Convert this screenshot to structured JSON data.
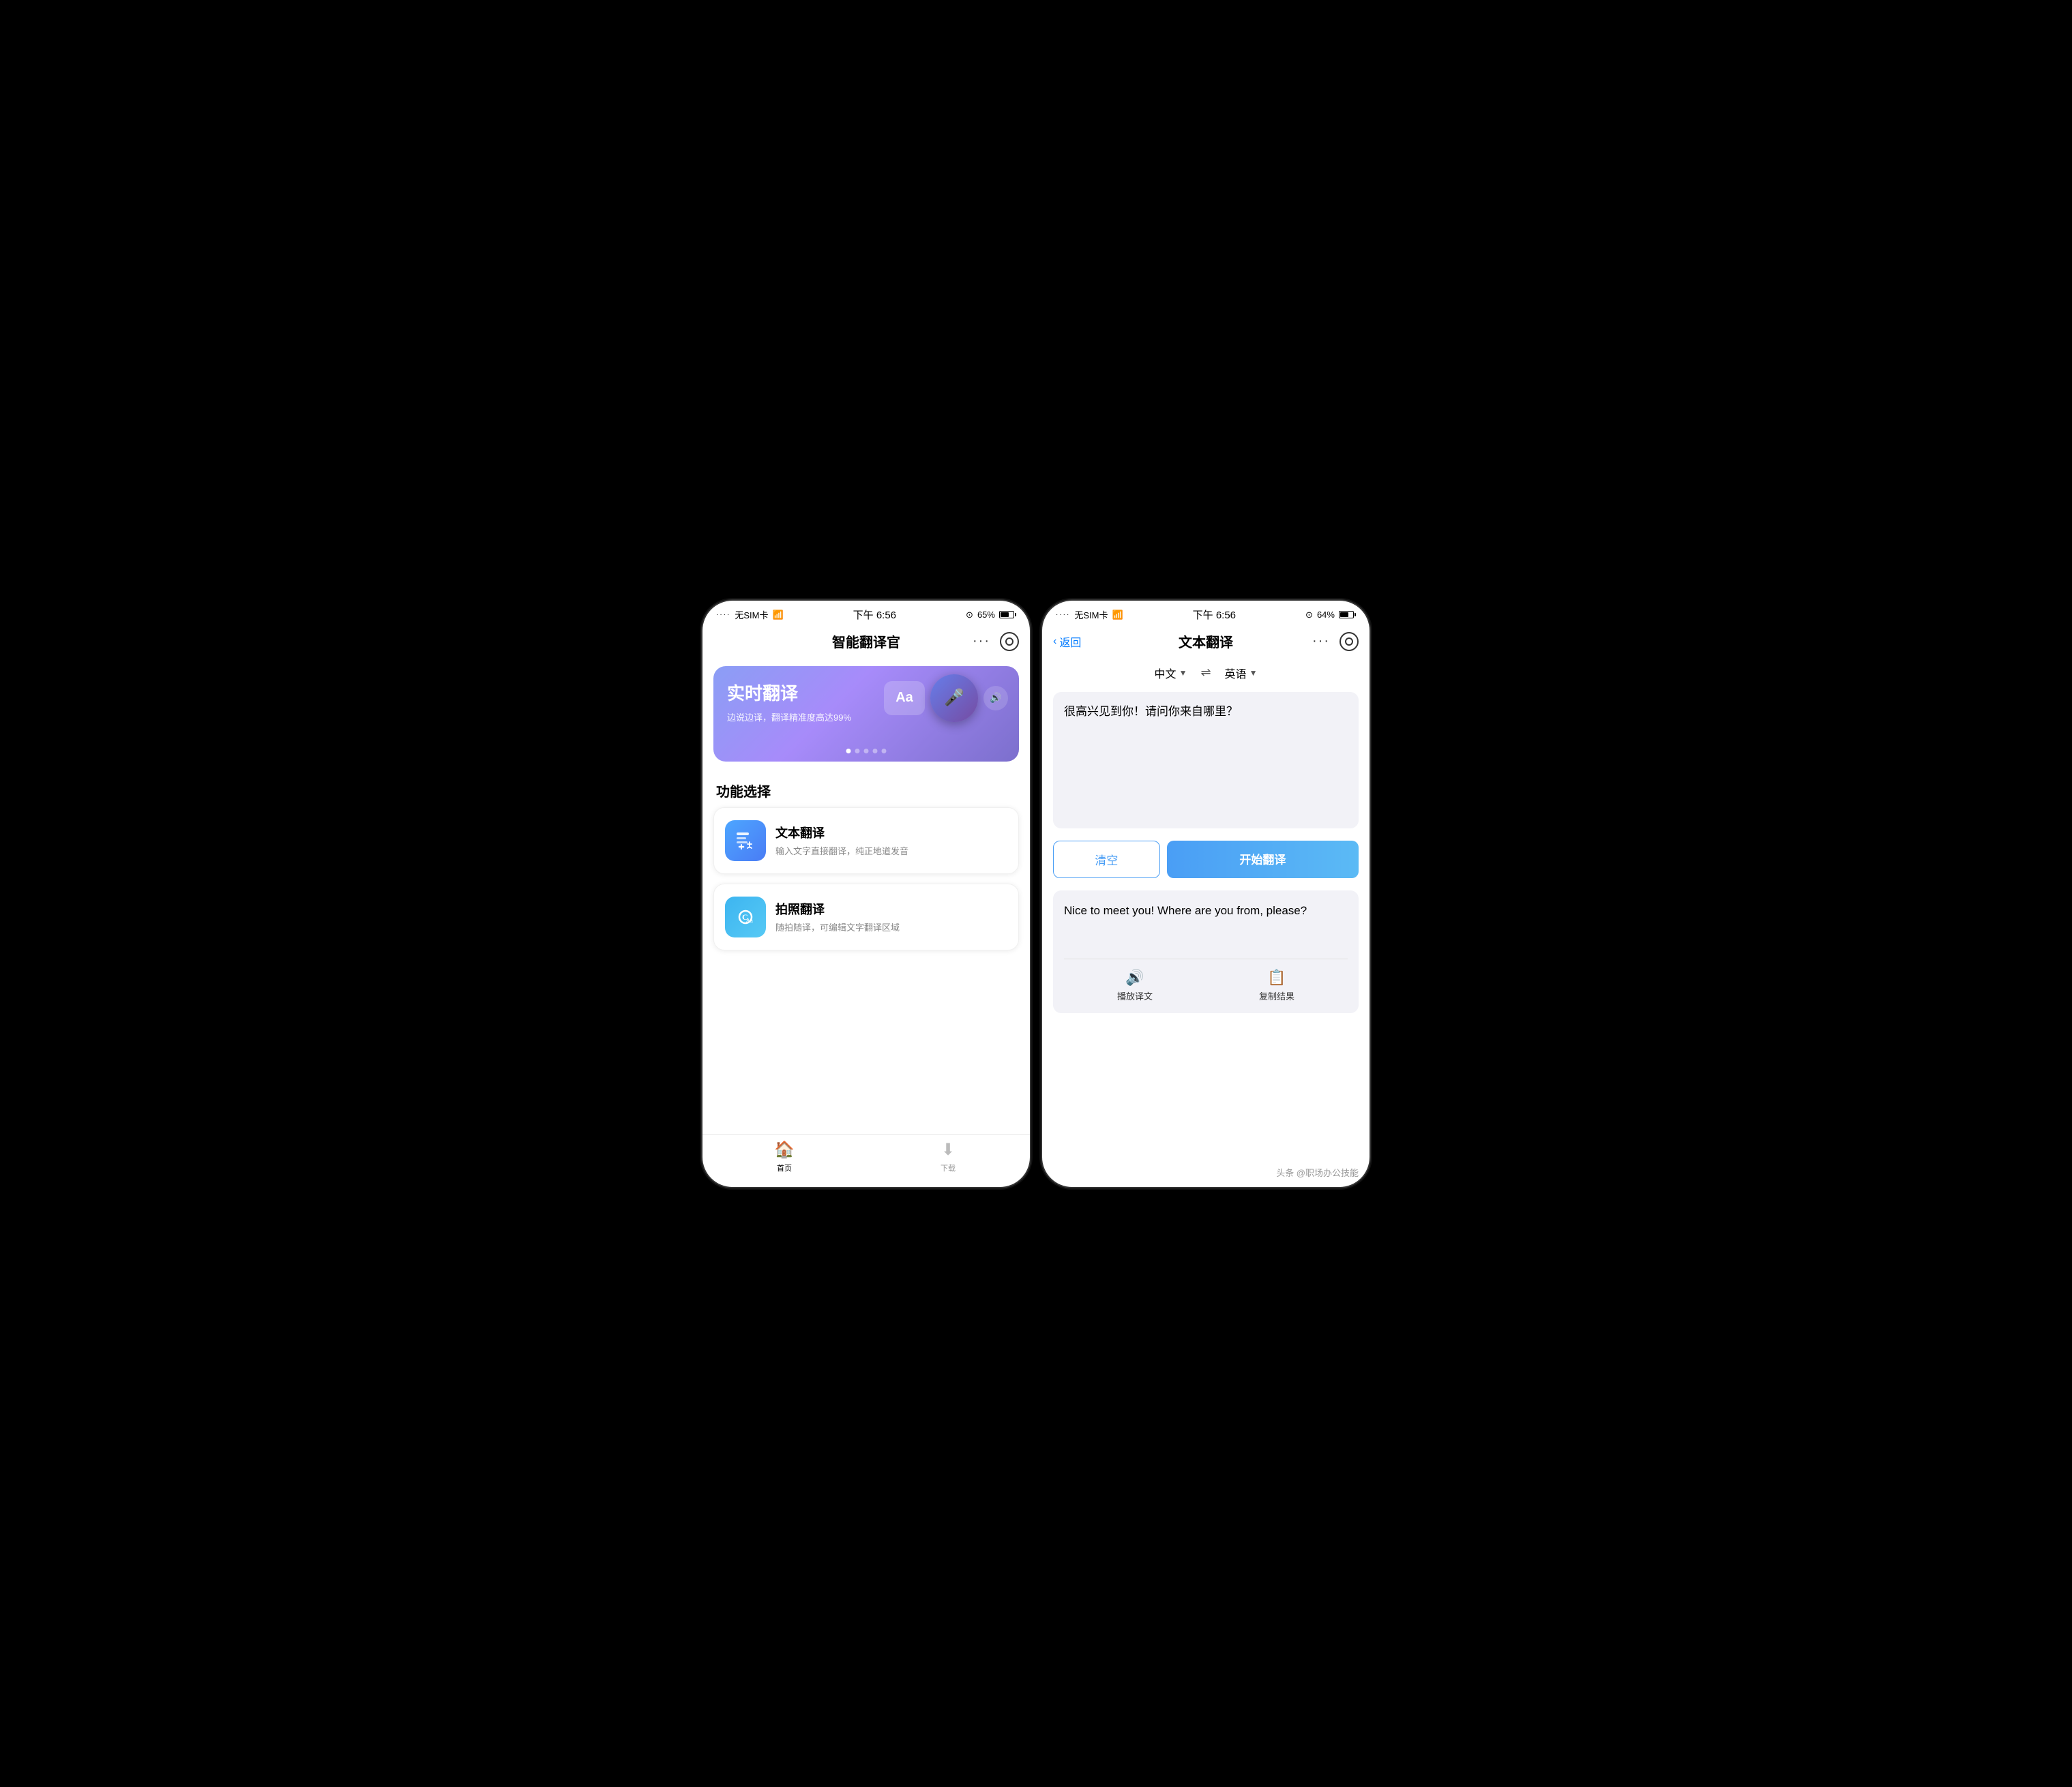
{
  "left_phone": {
    "status_bar": {
      "signal": "无SIM卡",
      "wifi": "WiFi",
      "time": "下午 6:56",
      "battery_pct": "65%",
      "battery_icon_label": "battery"
    },
    "nav": {
      "title": "智能翻译官",
      "more_icon": "···",
      "target_icon": "⊙"
    },
    "banner": {
      "title": "实时翻译",
      "subtitle": "边说边译，翻译精准度高达99%",
      "aa_label": "Aa",
      "dots": [
        true,
        false,
        false,
        false,
        false
      ]
    },
    "section_title": "功能选择",
    "features": [
      {
        "id": "text-translate",
        "title": "文本翻译",
        "subtitle": "输入文字直接翻译，纯正地道发音"
      },
      {
        "id": "photo-translate",
        "title": "拍照翻译",
        "subtitle": "随拍随译，可编辑文字翻译区域"
      }
    ],
    "tab_bar": {
      "tabs": [
        {
          "id": "home",
          "label": "首页",
          "active": true
        },
        {
          "id": "download",
          "label": "下载",
          "active": false
        }
      ]
    }
  },
  "right_phone": {
    "status_bar": {
      "signal": "无SIM卡",
      "wifi": "WiFi",
      "time": "下午 6:56",
      "battery_pct": "64%",
      "battery_icon_label": "battery"
    },
    "nav": {
      "back_label": "返回",
      "title": "文本翻译",
      "more_icon": "···",
      "target_icon": "⊙"
    },
    "lang_bar": {
      "source_lang": "中文",
      "target_lang": "英语",
      "swap_icon": "⇌"
    },
    "input_text": "很高兴见到你！请问你来自哪里？",
    "buttons": {
      "clear": "清空",
      "translate": "开始翻译"
    },
    "result_text": "Nice to meet you! Where are you from, please?",
    "result_actions": [
      {
        "id": "play",
        "icon": "🔊",
        "label": "播放译文"
      },
      {
        "id": "copy",
        "icon": "📋",
        "label": "复制结果"
      }
    ],
    "watermark": "头条 @职场办公技能"
  }
}
